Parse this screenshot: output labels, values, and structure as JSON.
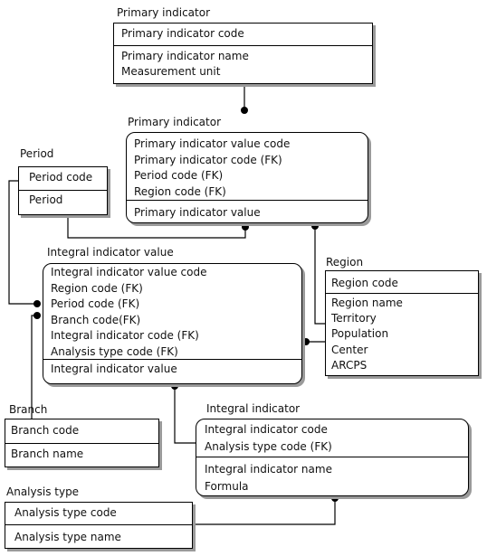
{
  "entities": {
    "primary_indicator": {
      "title": "Primary indicator",
      "key": [
        "Primary indicator code"
      ],
      "attributes": [
        "Primary indicator name",
        "Measurement unit"
      ]
    },
    "primary_indicator_value": {
      "title": "Primary indicator",
      "key": [
        "Primary indicator value code",
        "Primary indicator code (FK)",
        "Period code (FK)",
        "Region code (FK)"
      ],
      "attributes": [
        "Primary indicator value"
      ]
    },
    "period": {
      "title": "Period",
      "key": [
        "Period code"
      ],
      "attributes": [
        "Period"
      ]
    },
    "integral_indicator_value": {
      "title": "Integral indicator value",
      "key": [
        "Integral indicator value code",
        "Region code (FK)",
        "Period code (FK)",
        "Branch code(FK)",
        "Integral indicator code (FK)",
        "Analysis type code (FK)"
      ],
      "attributes": [
        "Integral indicator value"
      ]
    },
    "region": {
      "title": "Region",
      "key": [
        "Region code"
      ],
      "attributes": [
        "Region name",
        "Territory",
        "Population",
        "Center",
        "ARCPS"
      ]
    },
    "branch": {
      "title": "Branch",
      "key": [
        "Branch code"
      ],
      "attributes": [
        "Branch name"
      ]
    },
    "integral_indicator": {
      "title": "Integral indicator",
      "key": [
        "Integral indicator code",
        "Analysis type code (FK)"
      ],
      "attributes": [
        "Integral indicator name",
        "Formula"
      ]
    },
    "analysis_type": {
      "title": "Analysis type",
      "key": [
        "Analysis type code"
      ],
      "attributes": [
        "Analysis type name"
      ]
    }
  }
}
